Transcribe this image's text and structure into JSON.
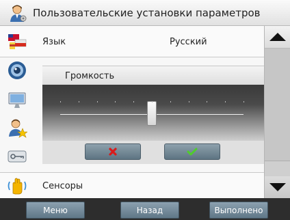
{
  "window": {
    "title": "Пользовательские установки параметров",
    "title_icon": "user-settings-icon"
  },
  "rows": {
    "language": {
      "icon": "flag-icon",
      "label": "Язык",
      "value": "Русский"
    },
    "sensors": {
      "icon": "hand-sensor-icon",
      "label": "Сенсоры"
    }
  },
  "sidebar_icons": [
    "speaker-icon",
    "monitor-icon",
    "user-star-icon",
    "key-icon"
  ],
  "volume_dialog": {
    "title": "Громкость",
    "level": 0.5,
    "tick_count": 11,
    "cancel_icon": "close-icon",
    "accept_icon": "checkmark-icon",
    "cancel_color": "#d91b1b",
    "accept_color": "#4fce2a"
  },
  "scrollbar": {
    "up_icon": "triangle-up-icon",
    "down_icon": "triangle-down-icon"
  },
  "bottom_bar": {
    "menu_label": "Меню",
    "back_label": "Назад",
    "done_label": "Выполнено"
  }
}
